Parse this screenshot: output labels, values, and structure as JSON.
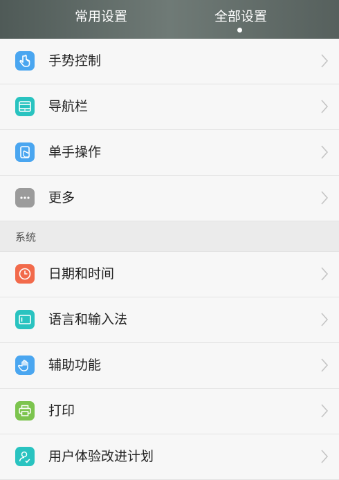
{
  "tabs": {
    "common_label": "常用设置",
    "all_label": "全部设置"
  },
  "group1": [
    {
      "label": "手势控制",
      "icon": "gesture-icon",
      "color": "#4aa6f0"
    },
    {
      "label": "导航栏",
      "icon": "navbar-icon",
      "color": "#29c3c0"
    },
    {
      "label": "单手操作",
      "icon": "one-hand-icon",
      "color": "#4aa6f0"
    },
    {
      "label": "更多",
      "icon": "more-icon",
      "color": "#9b9b9b"
    }
  ],
  "section": {
    "title": "系统"
  },
  "group2": [
    {
      "label": "日期和时间",
      "icon": "clock-icon",
      "color": "#f26a4b"
    },
    {
      "label": "语言和输入法",
      "icon": "keyboard-icon",
      "color": "#29c3c0"
    },
    {
      "label": "辅助功能",
      "icon": "hand-icon",
      "color": "#4aa6f0"
    },
    {
      "label": "打印",
      "icon": "printer-icon",
      "color": "#7cc44e"
    },
    {
      "label": "用户体验改进计划",
      "icon": "user-experience-icon",
      "color": "#29c3c0"
    }
  ]
}
